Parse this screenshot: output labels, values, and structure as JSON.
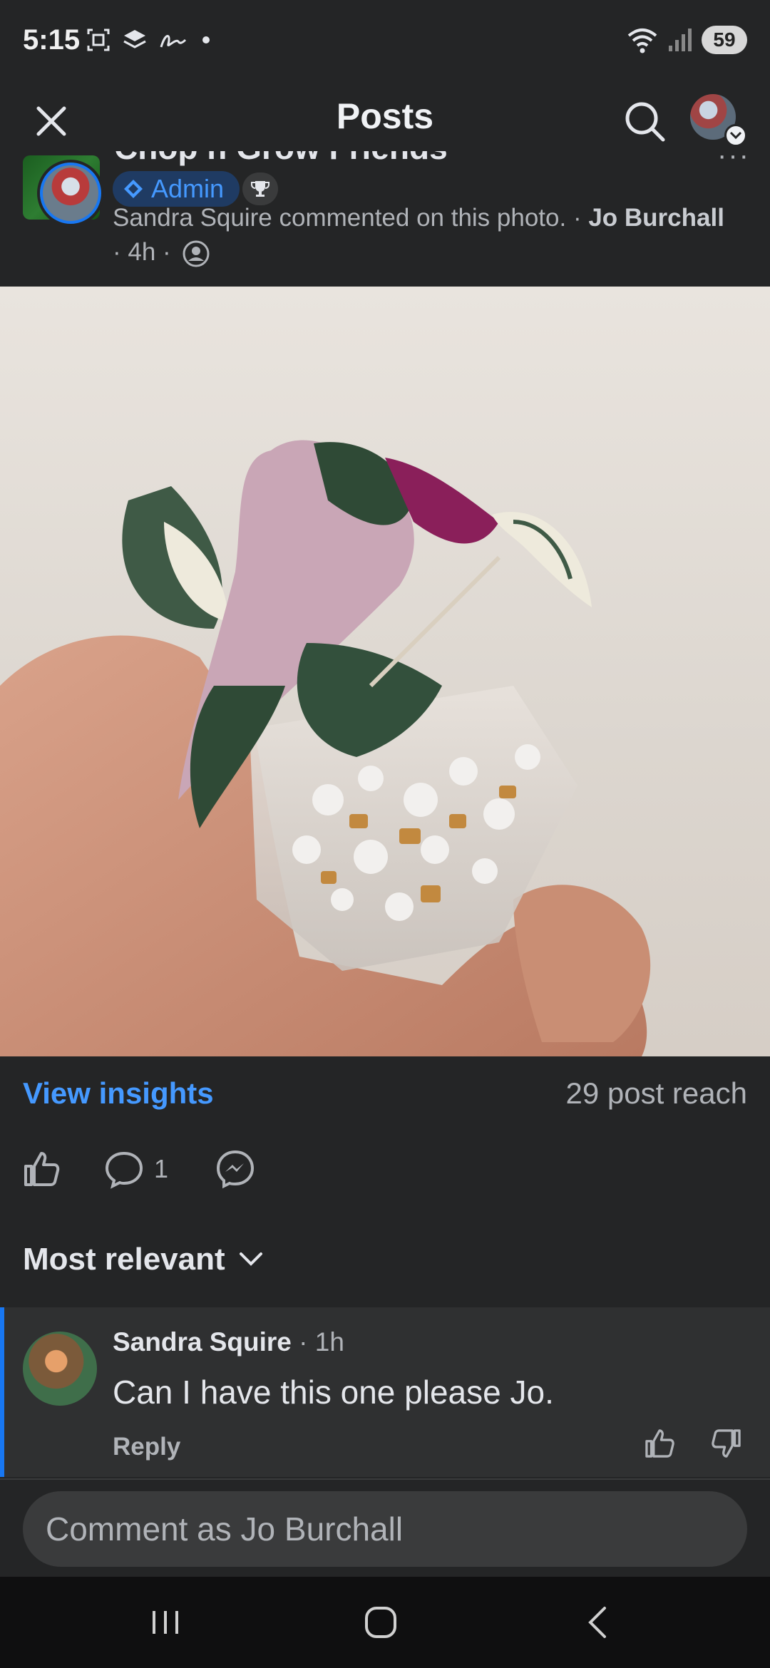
{
  "status_bar": {
    "time": "5:15",
    "battery": "59"
  },
  "app_bar": {
    "title": "Posts"
  },
  "post": {
    "group_name": "Chop n Grow Friends",
    "more": "···",
    "admin_label": "Admin",
    "meta_prefix": "Sandra Squire commented on this photo. · ",
    "author": "Jo Burchall",
    "time": "· 4h ·"
  },
  "insights": {
    "view_label": "View insights",
    "reach": "29 post reach"
  },
  "actions": {
    "comment_count": "1"
  },
  "sort": {
    "label": "Most relevant"
  },
  "comment": {
    "author": "Sandra Squire",
    "time": " · 1h",
    "text": "Can I have this one please Jo.",
    "reply_label": "Reply"
  },
  "comment_input": {
    "placeholder": "Comment as Jo Burchall"
  },
  "colors": {
    "background": "#242526",
    "accent": "#1877f2",
    "link": "#4599ff"
  }
}
